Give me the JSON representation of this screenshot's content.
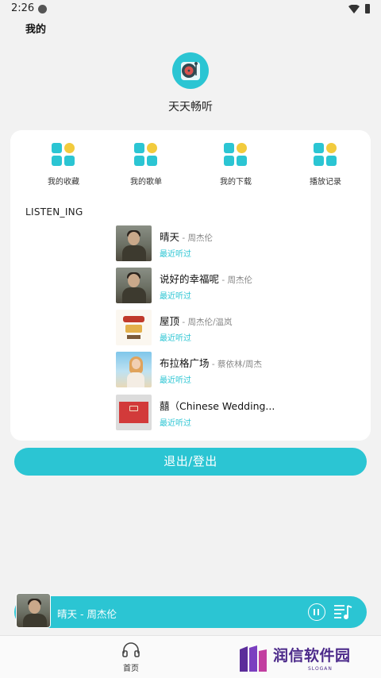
{
  "status_bar": {
    "time": "2:26"
  },
  "header": {
    "title": "我的"
  },
  "app": {
    "name": "天天畅听"
  },
  "shortcuts": [
    {
      "label": "我的收藏"
    },
    {
      "label": "我的歌单"
    },
    {
      "label": "我的下载"
    },
    {
      "label": "播放记录"
    }
  ],
  "listening": {
    "section_title": "LISTEN_ING",
    "songs": [
      {
        "title": "晴天",
        "artist": " - 周杰伦",
        "sub": "最近听过"
      },
      {
        "title": "说好的幸福呢",
        "artist": " - 周杰伦",
        "sub": "最近听过"
      },
      {
        "title": "屋顶",
        "artist": " - 周杰伦/温岚",
        "sub": "最近听过"
      },
      {
        "title": "布拉格广场",
        "artist": " - 蔡依林/周杰",
        "sub": "最近听过"
      },
      {
        "title": "囍（Chinese Wedding...",
        "artist": "",
        "sub": "最近听过"
      }
    ]
  },
  "logout": {
    "label": "退出/登出"
  },
  "player": {
    "title": "晴天 - 周杰伦"
  },
  "bottom_nav": {
    "home_label": "首页"
  },
  "watermark": {
    "text": "润信软件园",
    "slogan": "SLOGAN"
  },
  "colors": {
    "accent": "#2bc5d3",
    "accent_yellow": "#f2cb3d",
    "background": "#f2f2f2"
  },
  "icons": {
    "logo": "vinyl-record-icon",
    "shortcut": "grid-icon",
    "pause": "pause-icon",
    "playlist": "playlist-icon",
    "home": "headphones-icon"
  }
}
